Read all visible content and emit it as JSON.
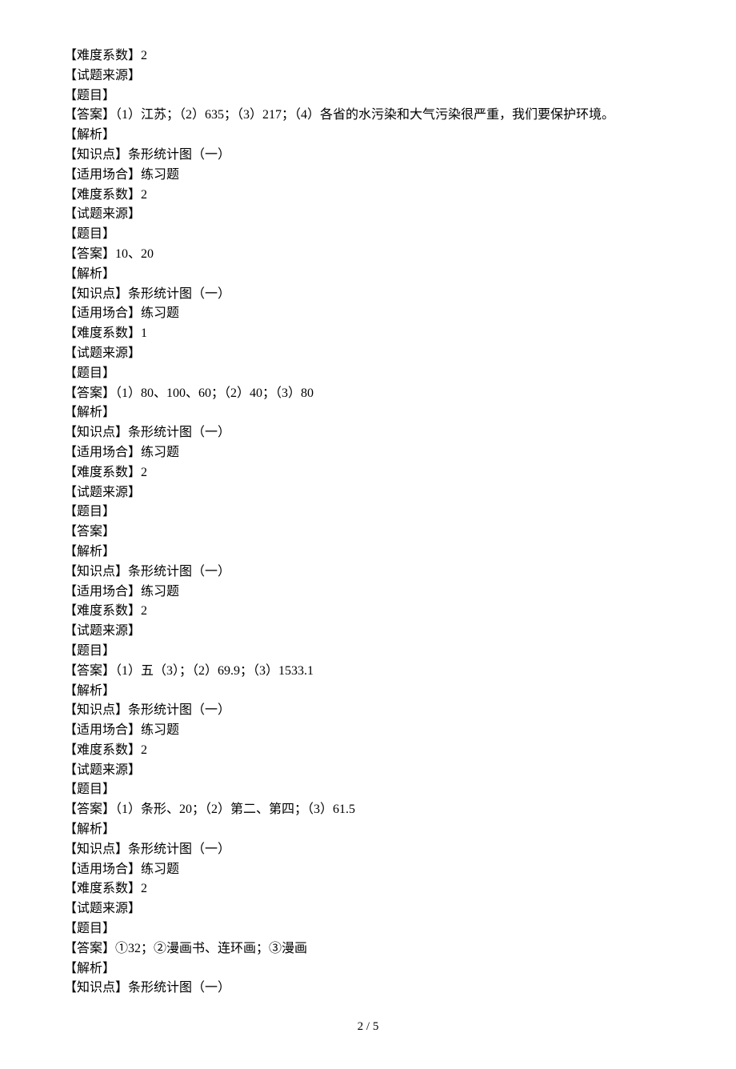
{
  "lines": [
    "【难度系数】2",
    "【试题来源】",
    "【题目】",
    "【答案】（1）江苏；（2）635；（3）217；（4）各省的水污染和大气污染很严重，我们要保护环境。",
    "【解析】",
    "【知识点】条形统计图（一）",
    "【适用场合】练习题",
    "【难度系数】2",
    "【试题来源】",
    "【题目】",
    "【答案】10、20",
    "【解析】",
    "【知识点】条形统计图（一）",
    "【适用场合】练习题",
    "【难度系数】1",
    "【试题来源】",
    "【题目】",
    "【答案】（1）80、100、60；（2）40；（3）80",
    "【解析】",
    "【知识点】条形统计图（一）",
    "【适用场合】练习题",
    "【难度系数】2",
    "【试题来源】",
    "【题目】",
    "【答案】",
    "【解析】",
    "【知识点】条形统计图（一）",
    "【适用场合】练习题",
    "【难度系数】2",
    "【试题来源】",
    "【题目】",
    "【答案】（1）五（3）；（2）69.9；（3）1533.1",
    "【解析】",
    "【知识点】条形统计图（一）",
    "【适用场合】练习题",
    "【难度系数】2",
    "【试题来源】",
    "【题目】",
    "【答案】（1）条形、20；（2）第二、第四；（3）61.5",
    "【解析】",
    "【知识点】条形统计图（一）",
    "【适用场合】练习题",
    "【难度系数】2",
    "【试题来源】",
    "【题目】",
    "【答案】①32；②漫画书、连环画；③漫画",
    "【解析】",
    "【知识点】条形统计图（一）"
  ],
  "footer": "2 / 5"
}
